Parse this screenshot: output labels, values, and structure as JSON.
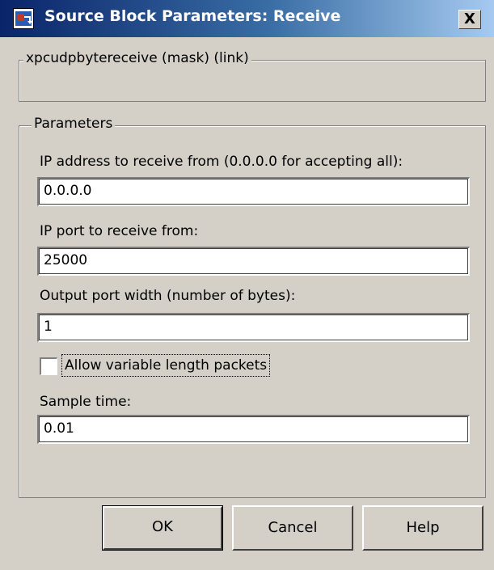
{
  "window": {
    "title": "Source Block Parameters: Receive",
    "close_label": "X",
    "icon": "simulink-block-icon"
  },
  "mask_group": {
    "legend": "xpcudpbytereceive (mask) (link)"
  },
  "params_group": {
    "legend": "Parameters",
    "ip_address": {
      "label": "IP address to receive from (0.0.0.0 for accepting all):",
      "value": "0.0.0.0"
    },
    "ip_port": {
      "label": "IP port to receive from:",
      "value": "25000"
    },
    "output_width": {
      "label": "Output port width (number of bytes):",
      "value": "1"
    },
    "variable_length": {
      "label": "Allow variable length packets",
      "checked": false
    },
    "sample_time": {
      "label": "Sample time:",
      "value": "0.01"
    }
  },
  "buttons": {
    "ok": "OK",
    "cancel": "Cancel",
    "help": "Help"
  }
}
